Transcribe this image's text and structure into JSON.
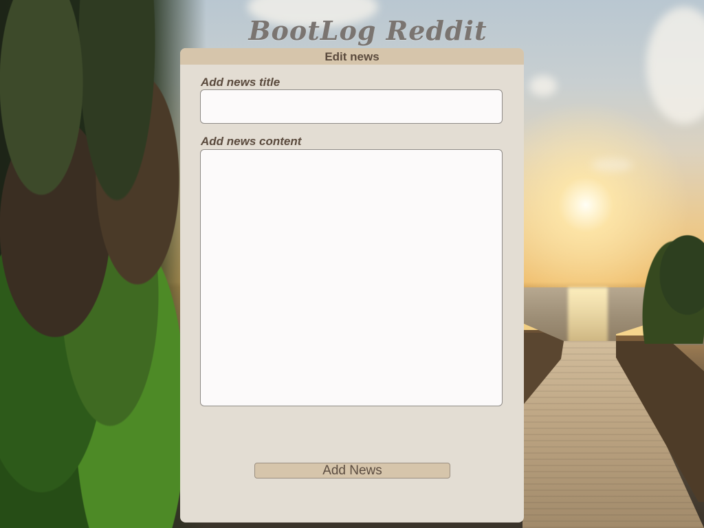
{
  "site": {
    "title": "BootLog Reddit"
  },
  "panel": {
    "header": "Edit news"
  },
  "form": {
    "title_label": "Add news title",
    "title_value": "",
    "content_label": "Add news content",
    "content_value": "",
    "submit_label": "Add News"
  },
  "colors": {
    "panel_bg": "#e3ddd3",
    "accent": "#d6c5ab",
    "label_text": "#5a4a3d",
    "site_title": "#7a7470"
  }
}
